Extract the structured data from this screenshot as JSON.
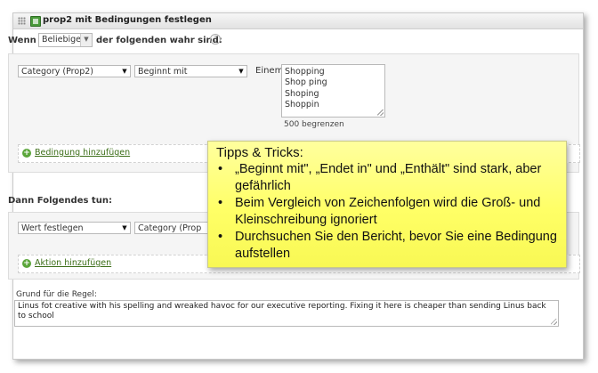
{
  "window": {
    "title": "prop2 mit Bedingungen festlegen"
  },
  "conditions": {
    "wenn_label": "Wenn",
    "match_select": "Beliebige",
    "tail_label": "der folgenden wahr sind:",
    "rule": {
      "field": "Category (Prop2)",
      "operator": "Beginnt mit",
      "value_label": "Einem",
      "values": [
        "Shopping",
        "Shop ping",
        "Shoping",
        "Shoppin"
      ],
      "limit_text": "500 begrenzen"
    },
    "add_label": "Bedingung hinzufügen"
  },
  "actions": {
    "heading": "Dann Folgendes tun:",
    "action": "Wert festlegen",
    "field": "Category (Prop",
    "add_label": "Aktion hinzufügen"
  },
  "reason": {
    "label": "Grund für die Regel:",
    "text": "Linus fot creative with his spelling and wreaked havoc for our executive reporting. Fixing it here is cheaper than sending Linus back to school"
  },
  "tips": {
    "title": "Tipps & Tricks:",
    "items": [
      "„Beginnt mit\", „Endet in\" und „Enthält\" sind stark, aber gefährlich",
      "Beim Vergleich von Zeichenfolgen wird die Groß- und Kleinschreibung ignoriert",
      "Durchsuchen Sie den Bericht, bevor Sie eine Bedingung aufstellen"
    ]
  },
  "colors": {
    "accent_green": "#4a9a3a",
    "link_green": "#3c6e18",
    "tip_yellow": "#ffff66"
  }
}
